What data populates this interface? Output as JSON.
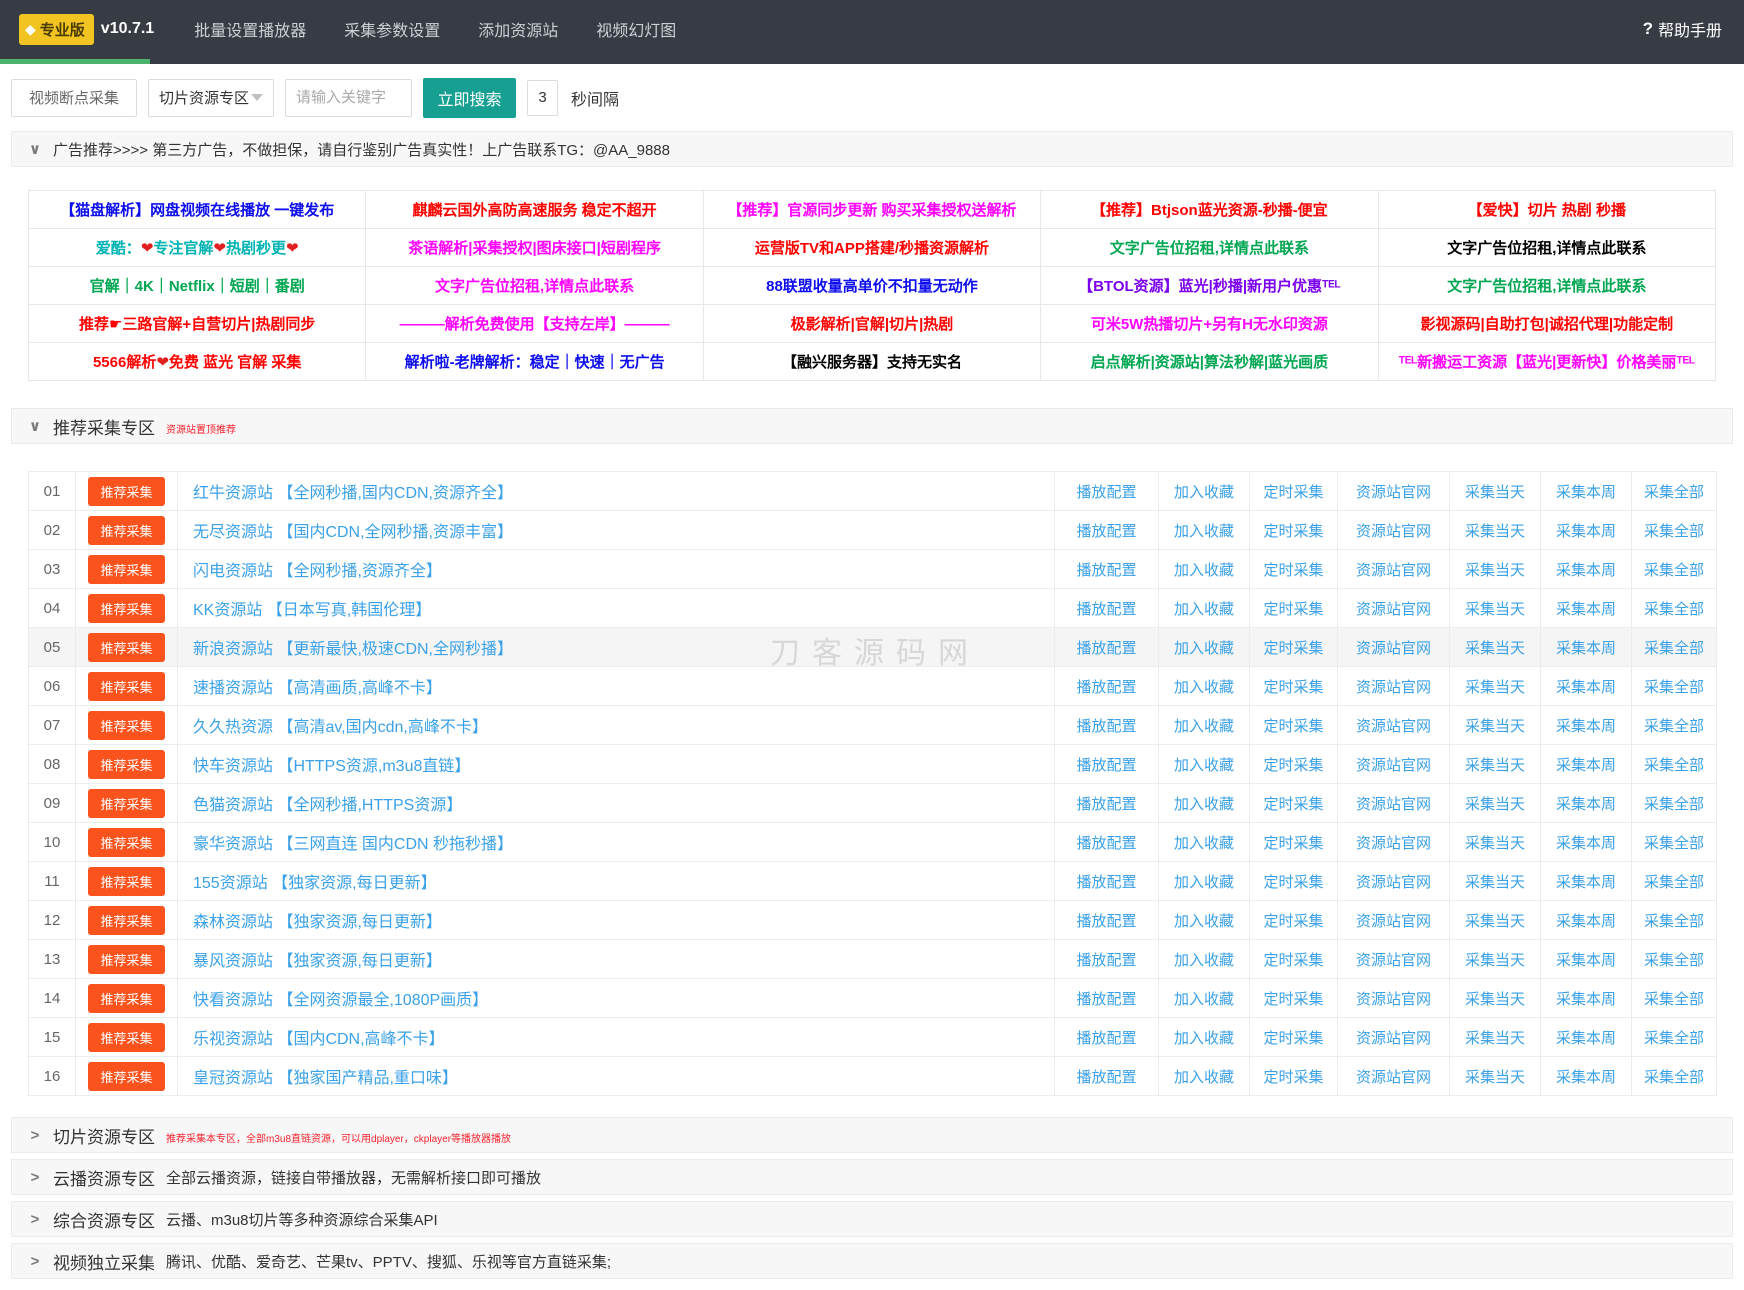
{
  "navbar": {
    "badge": "专业版",
    "version": "v10.7.1",
    "menu": [
      "批量设置播放器",
      "采集参数设置",
      "添加资源站",
      "视频幻灯图"
    ],
    "help_icon": "?",
    "help": "帮助手册",
    "accent_green": "#4cb36c",
    "bg": "#363b44"
  },
  "search": {
    "resume_button": "视频断点采集",
    "category_select": "切片资源专区",
    "keyword_placeholder": "请输入关键字",
    "search_button": "立即搜索",
    "search_button_color": "#17a091",
    "interval_value": "3",
    "interval_label": "秒间隔"
  },
  "ads": {
    "header": "广告推荐>>>>  第三方广告，不做担保，请自行鉴别广告真实性！上广告联系TG：@AA_9888",
    "rows": [
      [
        {
          "text": "【猫盘解析】网盘视频在线播放 一键发布",
          "color": "#0d0dee"
        },
        {
          "text": "麒麟云国外高防高速服务 稳定不超开",
          "color": "#ff0000"
        },
        {
          "text": "【推荐】官源同步更新 购买采集授权送解析",
          "color": "#ff00ff"
        },
        {
          "text": "【推荐】Btjson蓝光资源-秒播-便宜",
          "color": "#ff0000"
        },
        {
          "text": "【爱快】切片 热剧 秒播",
          "color": "#ff0000"
        }
      ],
      [
        {
          "text": "爱酷：❤专注官解❤热剧秒更❤",
          "color": "#00b3b3"
        },
        {
          "text": "茶语解析|采集授权|图床接口|短剧程序",
          "color": "#ff00ff"
        },
        {
          "text": "运营版TV和APP搭建/秒播资源解析",
          "color": "#ff0000"
        },
        {
          "text": "文字广告位招租,详情点此联系",
          "color": "#00a651"
        },
        {
          "text": "文字广告位招租,详情点此联系",
          "color": "#000000"
        }
      ],
      [
        {
          "text": "官解｜4K｜Netflix｜短剧｜番剧",
          "color": "#00a651"
        },
        {
          "text": "文字广告位招租,详情点此联系",
          "color": "#ff00ff"
        },
        {
          "text": "88联盟收量高单价不扣量无动作",
          "color": "#0d0dee"
        },
        {
          "text": "【BTOL资源】蓝光|秒播|新用户优惠ᵀᴱᴸ",
          "color": "#7b00f0"
        },
        {
          "text": "文字广告位招租,详情点此联系",
          "color": "#00a651"
        }
      ],
      [
        {
          "text": "推荐☛三路官解+自营切片|热剧同步",
          "color": "#ff0000"
        },
        {
          "text": "———解析免费使用【支持左岸】———",
          "color": "#ff00ff"
        },
        {
          "text": "极影解析|官解|切片|热剧",
          "color": "#ff0000"
        },
        {
          "text": "可米5W热播切片+另有H无水印资源",
          "color": "#ff00ff"
        },
        {
          "text": "影视源码|自助打包|诚招代理|功能定制",
          "color": "#ff0000"
        }
      ],
      [
        {
          "text": "5566解析❤免费 蓝光 官解 采集",
          "color": "#ff0000"
        },
        {
          "text": "解析啦-老牌解析：稳定｜快速｜无广告",
          "color": "#0d0dee"
        },
        {
          "text": "【融兴服务器】支持无实名",
          "color": "#000000"
        },
        {
          "text": "启点解析|资源站|算法秒解|蓝光画质",
          "color": "#00a651"
        },
        {
          "text": "ᵀᴱᴸ新搬运工资源【蓝光|更新快】价格美丽ᵀᴱᴸ",
          "color": "#ff00ff"
        }
      ]
    ]
  },
  "recommend": {
    "title": "推荐采集专区",
    "note": "资源站置顶推荐",
    "badge_label": "推荐采集",
    "badge_color": "#fb531d",
    "link_color": "#3ba1e8",
    "actions": [
      "播放配置",
      "加入收藏",
      "定时采集",
      "资源站官网",
      "采集当天",
      "采集本周",
      "采集全部"
    ],
    "rows": [
      {
        "num": "01",
        "name": "红牛资源站 【全网秒播,国内CDN,资源齐全】"
      },
      {
        "num": "02",
        "name": "无尽资源站 【国内CDN,全网秒播,资源丰富】"
      },
      {
        "num": "03",
        "name": "闪电资源站 【全网秒播,资源齐全】"
      },
      {
        "num": "04",
        "name": "KK资源站 【日本写真,韩国伦理】"
      },
      {
        "num": "05",
        "name": "新浪资源站 【更新最快,极速CDN,全网秒播】",
        "hover": true
      },
      {
        "num": "06",
        "name": "速播资源站 【高清画质,高峰不卡】"
      },
      {
        "num": "07",
        "name": "久久热资源 【高清av,国内cdn,高峰不卡】"
      },
      {
        "num": "08",
        "name": "快车资源站 【HTTPS资源,m3u8直链】"
      },
      {
        "num": "09",
        "name": "色猫资源站 【全网秒播,HTTPS资源】"
      },
      {
        "num": "10",
        "name": "豪华资源站 【三网直连 国内CDN 秒拖秒播】"
      },
      {
        "num": "11",
        "name": "155资源站 【独家资源,每日更新】"
      },
      {
        "num": "12",
        "name": "森林资源站 【独家资源,每日更新】"
      },
      {
        "num": "13",
        "name": "暴风资源站 【独家资源,每日更新】"
      },
      {
        "num": "14",
        "name": "快看资源站 【全网资源最全,1080P画质】"
      },
      {
        "num": "15",
        "name": "乐视资源站 【国内CDN,高峰不卡】"
      },
      {
        "num": "16",
        "name": "皇冠资源站 【独家国产精品,重口味】"
      }
    ]
  },
  "watermark": "刀客源码网",
  "sections": [
    {
      "title": "切片资源专区",
      "note": "推荐采集本专区，全部m3u8直链资源，可以用dplayer，ckplayer等播放器播放",
      "note_style": "red"
    },
    {
      "title": "云播资源专区",
      "note": "全部云播资源，链接自带播放器，无需解析接口即可播放",
      "note_style": "plain"
    },
    {
      "title": "综合资源专区",
      "note": "云播、m3u8切片等多种资源综合采集API",
      "note_style": "plain"
    },
    {
      "title": "视频独立采集",
      "note": "腾讯、优酷、爱奇艺、芒果tv、PPTV、搜狐、乐视等官方直链采集;",
      "note_style": "plain"
    }
  ]
}
